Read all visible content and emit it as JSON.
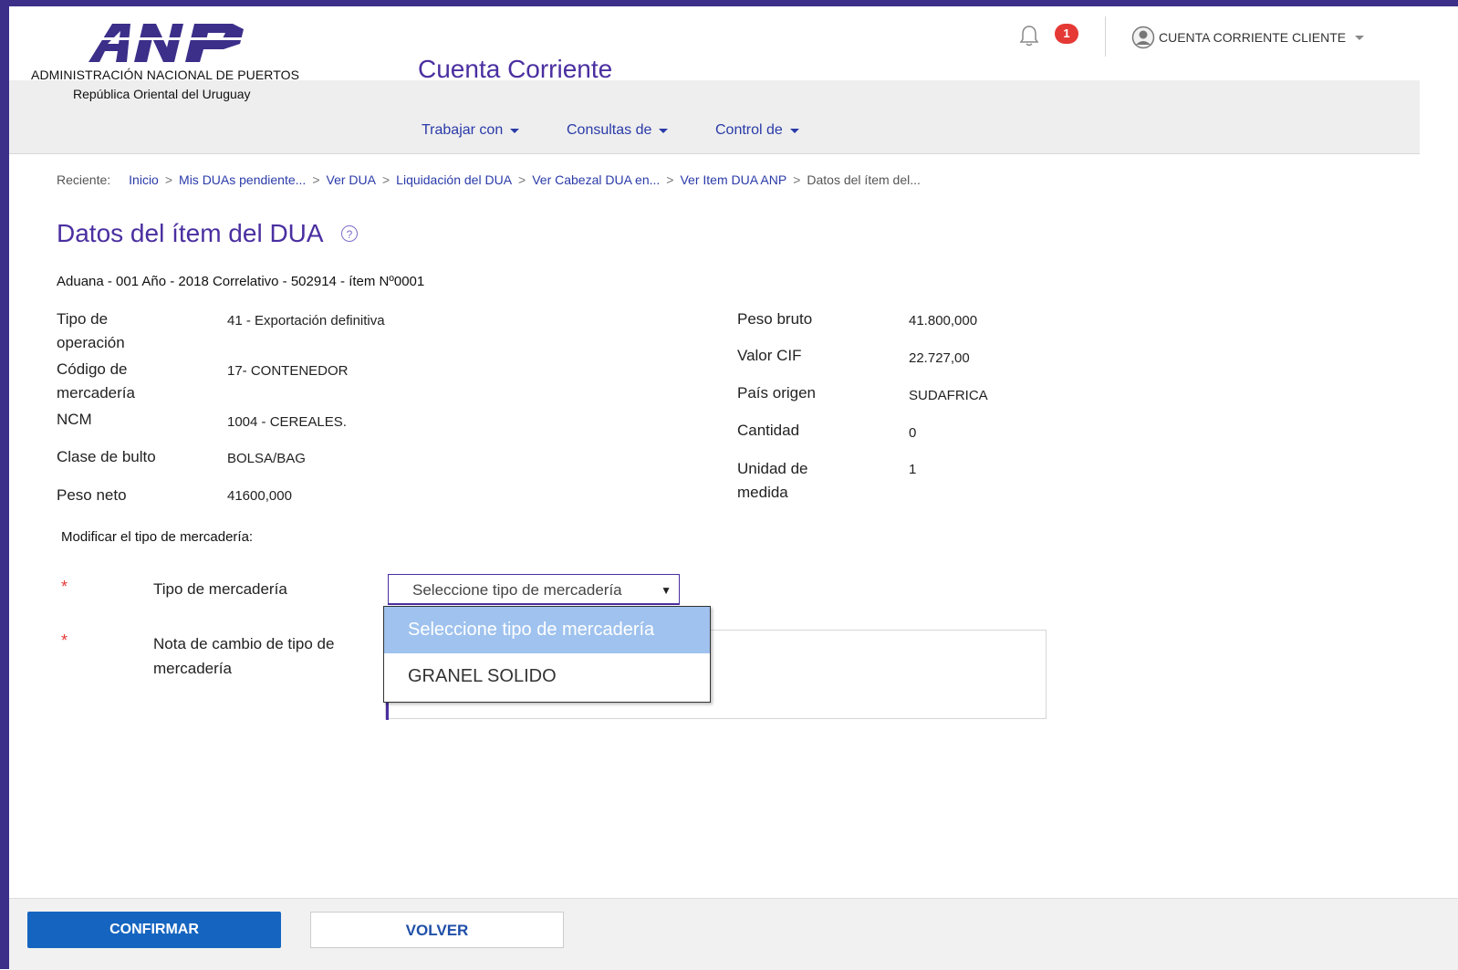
{
  "header": {
    "logo_text": "ANP",
    "org_name": "ADMINISTRACIÓN NACIONAL DE PUERTOS",
    "org_sub": "República Oriental del Uruguay",
    "app_title": "Cuenta Corriente",
    "notification_count": "1",
    "user_label": "CUENTA CORRIENTE CLIENTE"
  },
  "nav": {
    "items": [
      {
        "label": "Trabajar con"
      },
      {
        "label": "Consultas de"
      },
      {
        "label": "Control de"
      }
    ]
  },
  "breadcrumb": {
    "prefix": "Reciente:",
    "items": [
      "Inicio",
      "Mis DUAs pendiente...",
      "Ver DUA",
      "Liquidación del DUA",
      "Ver Cabezal DUA en...",
      "Ver Item DUA ANP"
    ],
    "current": "Datos del ítem del...",
    "separator": ">"
  },
  "page": {
    "title": "Datos del ítem del DUA",
    "help_glyph": "?",
    "subtitle": "Aduana - 001 Año - 2018 Correlativo - 502914 - ítem Nº0001"
  },
  "details_left": [
    {
      "label": "Tipo de operación",
      "value": "41 - Exportación definitiva"
    },
    {
      "label": "Código de mercadería",
      "value": "17- CONTENEDOR"
    },
    {
      "label": "NCM",
      "value": "1004 - CEREALES."
    },
    {
      "label": "Clase de bulto",
      "value": "BOLSA/BAG"
    },
    {
      "label": "Peso neto",
      "value": "41600,000"
    }
  ],
  "details_right": [
    {
      "label": "Peso bruto",
      "value": "41.800,000"
    },
    {
      "label": "Valor CIF",
      "value": "22.727,00"
    },
    {
      "label": "País origen",
      "value": "SUDAFRICA"
    },
    {
      "label": "Cantidad",
      "value": "0"
    },
    {
      "label": "Unidad de medida",
      "value": "1"
    }
  ],
  "form": {
    "section_label": "Modificar el tipo de mercadería:",
    "required_mark": "*",
    "tipo_label": "Tipo de mercadería",
    "tipo_selected": "Seleccione tipo de mercadería",
    "select_arrow": "▼",
    "nota_label": "Nota de cambio de tipo de mercadería",
    "dropdown_options": [
      "Seleccione tipo de mercadería",
      "GRANEL SOLIDO"
    ]
  },
  "footer": {
    "confirm_label": "CONFIRMAR",
    "back_label": "VOLVER"
  },
  "colors": {
    "brand_purple": "#4a2fa0",
    "link_blue": "#2a3aa8",
    "primary_button": "#1565c0",
    "badge_red": "#e53935",
    "dropdown_highlight": "#9fc2ee"
  },
  "icons": {
    "bell": "bell-icon",
    "user": "user-circle-icon",
    "help": "help-circle-icon"
  }
}
